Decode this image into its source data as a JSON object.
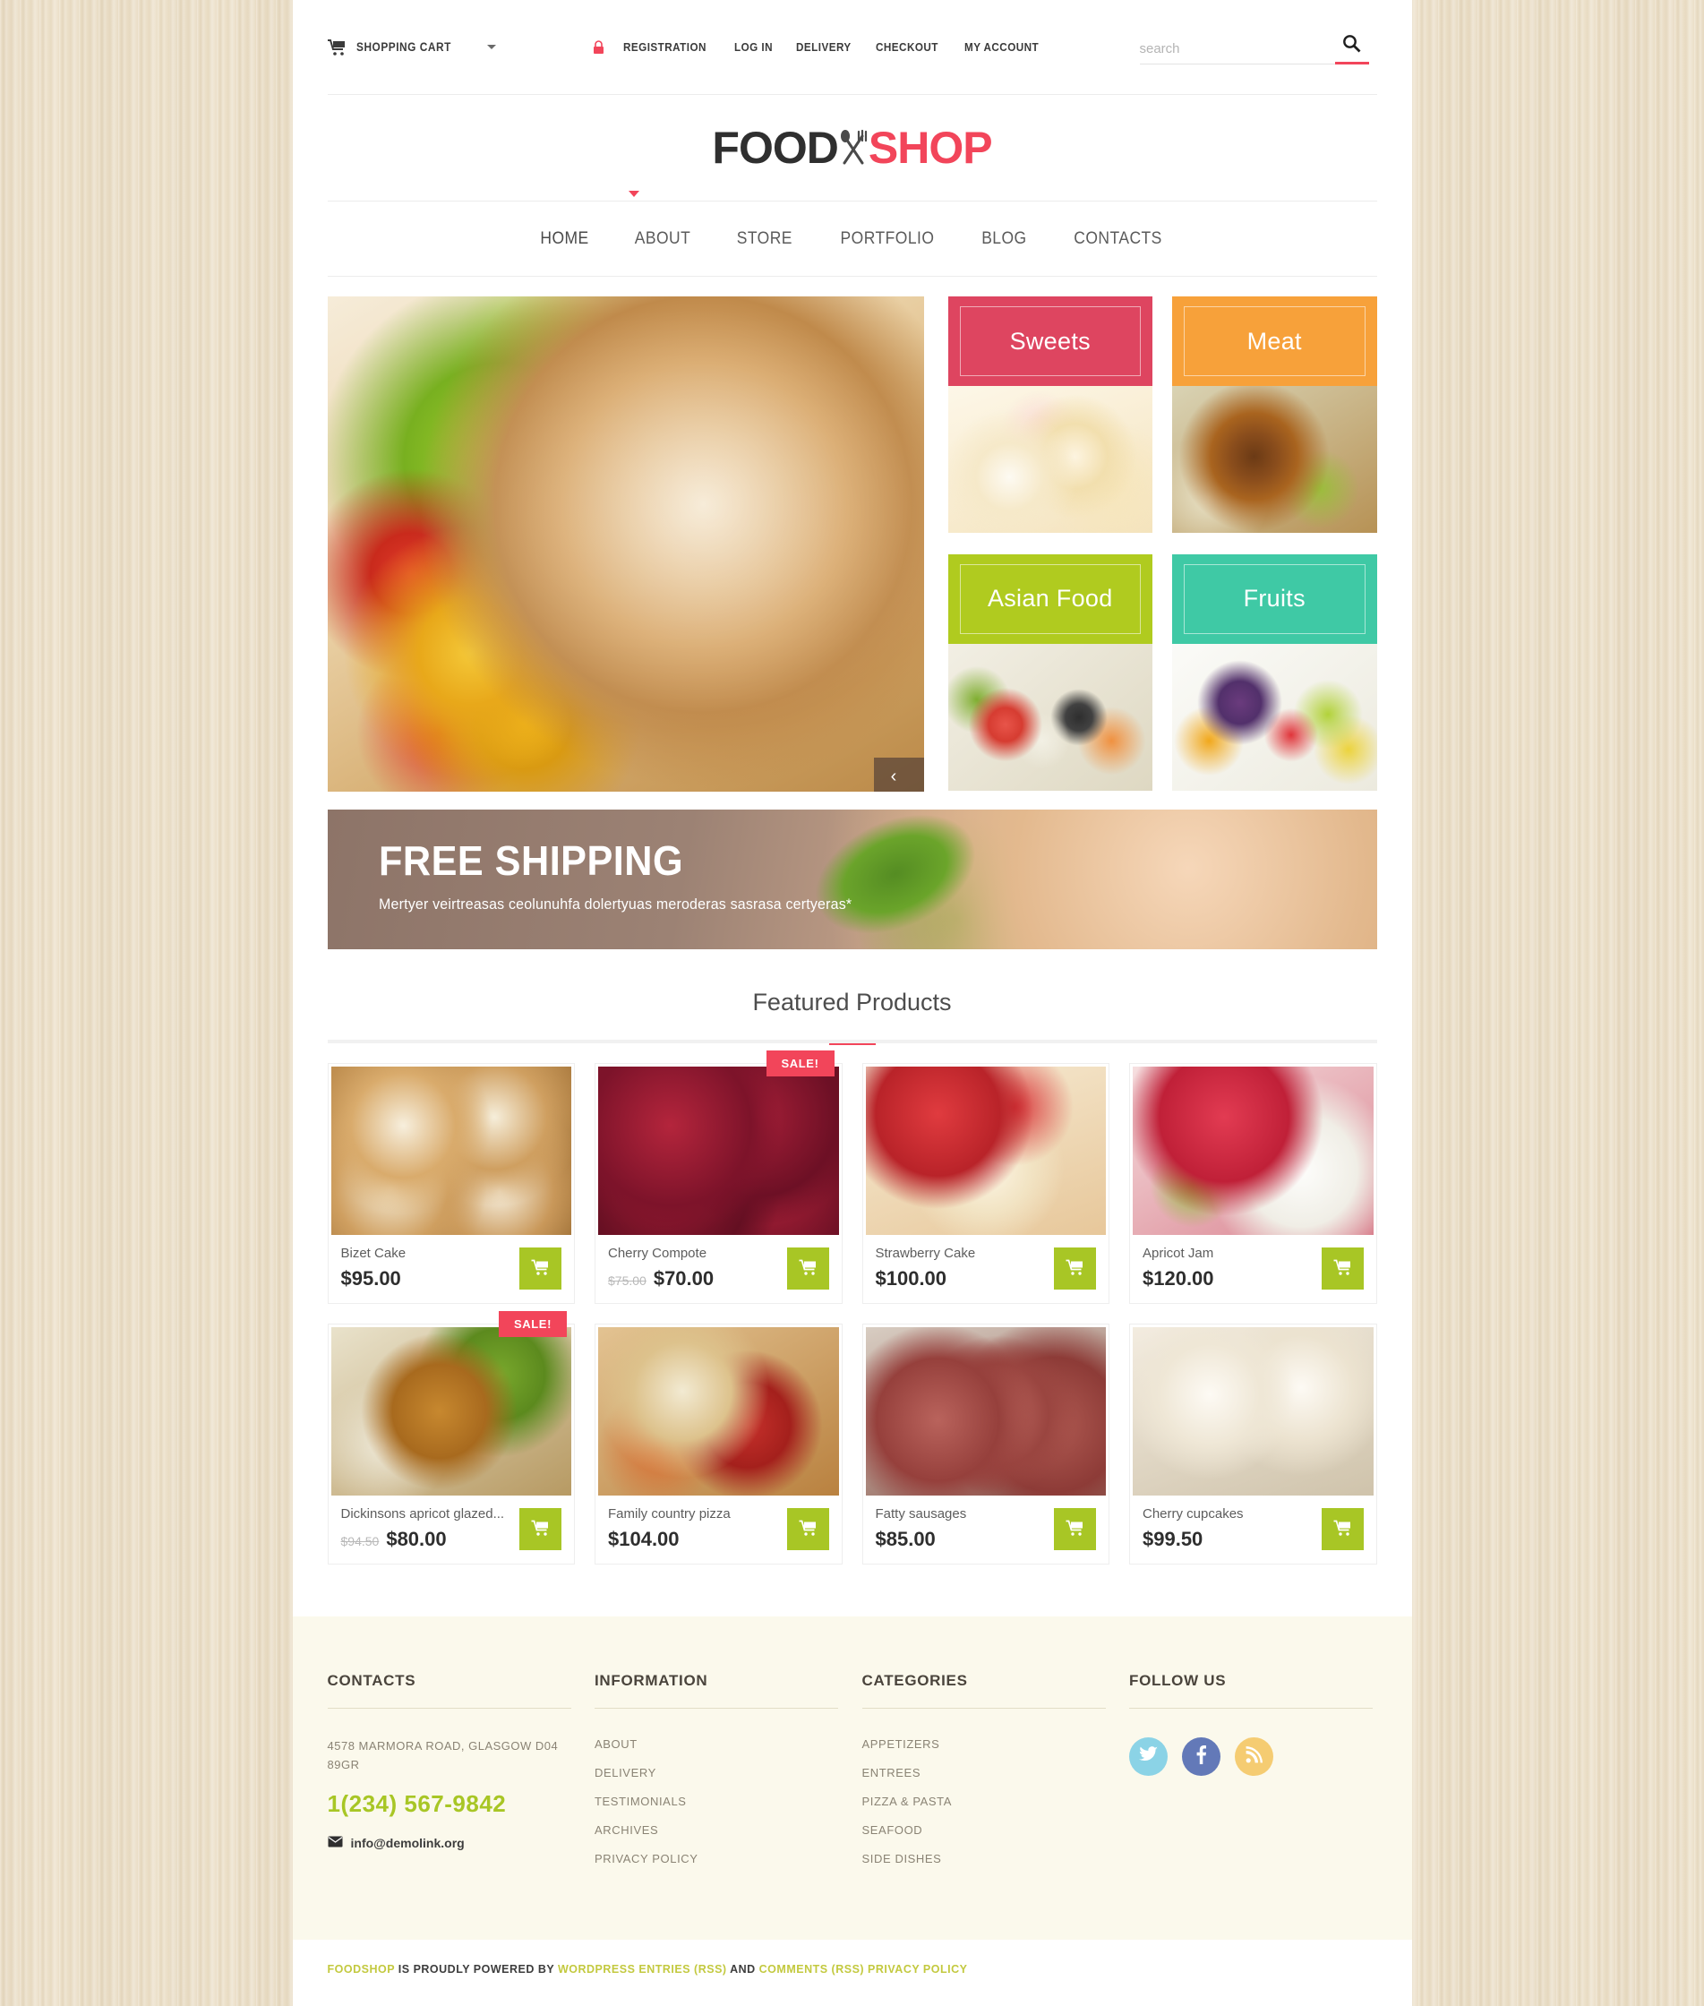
{
  "topbar": {
    "cart_label": "SHOPPING CART",
    "cart_icon": "shopping-cart-icon",
    "lock_icon": "lock-icon",
    "links": [
      "REGISTRATION",
      "LOG IN",
      "DELIVERY",
      "CHECKOUT",
      "MY ACCOUNT"
    ],
    "search_placeholder": "search",
    "search_value": "",
    "search_icon": "search-icon"
  },
  "logo": {
    "part1": "FOOD",
    "part2": "SHOP",
    "icon": "spoon-fork-icon"
  },
  "menu": {
    "items": [
      "HOME",
      "ABOUT",
      "STORE",
      "PORTFOLIO",
      "BLOG",
      "CONTACTS"
    ],
    "active": "HOME"
  },
  "hero": {
    "slider": {
      "prev": "‹",
      "next": "›"
    },
    "categories": [
      {
        "label": "Sweets",
        "color": "#DE4560"
      },
      {
        "label": "Meat",
        "color": "#F7A13A"
      },
      {
        "label": "Asian Food",
        "color": "#B0CB1F"
      },
      {
        "label": "Fruits",
        "color": "#3FC9A5"
      }
    ]
  },
  "shipping": {
    "title": "FREE SHIPPING",
    "subtitle": "Mertyer veirtreasas ceolunuhfa dolertyuas meroderas sasrasa certyeras*"
  },
  "featured": {
    "title": "Featured Products",
    "sale_badge": "SALE!",
    "cart_icon": "cart-add-icon",
    "products": [
      {
        "name": "Bizet Cake",
        "old_price": "",
        "price": "$95.00",
        "sale": false,
        "img": "img-bizet"
      },
      {
        "name": "Cherry Compote",
        "old_price": "$75.00",
        "price": "$70.00",
        "sale": true,
        "img": "img-cherry"
      },
      {
        "name": "Strawberry Cake",
        "old_price": "",
        "price": "$100.00",
        "sale": false,
        "img": "img-straw"
      },
      {
        "name": "Apricot Jam",
        "old_price": "",
        "price": "$120.00",
        "sale": false,
        "img": "img-apricot"
      },
      {
        "name": "Dickinsons apricot glazed...",
        "old_price": "$94.50",
        "price": "$80.00",
        "sale": true,
        "img": "img-dickinson"
      },
      {
        "name": "Family country pizza",
        "old_price": "",
        "price": "$104.00",
        "sale": false,
        "img": "img-pizza"
      },
      {
        "name": "Fatty sausages",
        "old_price": "",
        "price": "$85.00",
        "sale": false,
        "img": "img-saus"
      },
      {
        "name": "Cherry cupcakes",
        "old_price": "",
        "price": "$99.50",
        "sale": false,
        "img": "img-cupcake"
      }
    ]
  },
  "footer": {
    "contacts": {
      "heading": "CONTACTS",
      "address": "4578 MARMORA ROAD, GLASGOW D04 89GR",
      "phone": "1(234) 567-9842",
      "email": "info@demolink.org",
      "mail_icon": "envelope-icon"
    },
    "information": {
      "heading": "INFORMATION",
      "links": [
        "ABOUT",
        "DELIVERY",
        "TESTIMONIALS",
        "ARCHIVES",
        "PRIVACY POLICY"
      ]
    },
    "categories": {
      "heading": "CATEGORIES",
      "links": [
        "APPETIZERS",
        "ENTREES",
        "PIZZA & PASTA",
        "SEAFOOD",
        "SIDE DISHES"
      ]
    },
    "follow": {
      "heading": "FOLLOW US",
      "socials": [
        {
          "name": "twitter-icon",
          "color": "#8BD3E6"
        },
        {
          "name": "facebook-icon",
          "color": "#6379B8"
        },
        {
          "name": "rss-icon",
          "color": "#F5CC72"
        }
      ]
    }
  },
  "copyright": {
    "brand": "FOODSHOP",
    "mid1": " IS PROUDLY POWERED BY ",
    "link1": "WORDPRESS ENTRIES (RSS)",
    "mid2": " AND ",
    "link2": "COMMENTS (RSS) PRIVACY POLICY"
  }
}
